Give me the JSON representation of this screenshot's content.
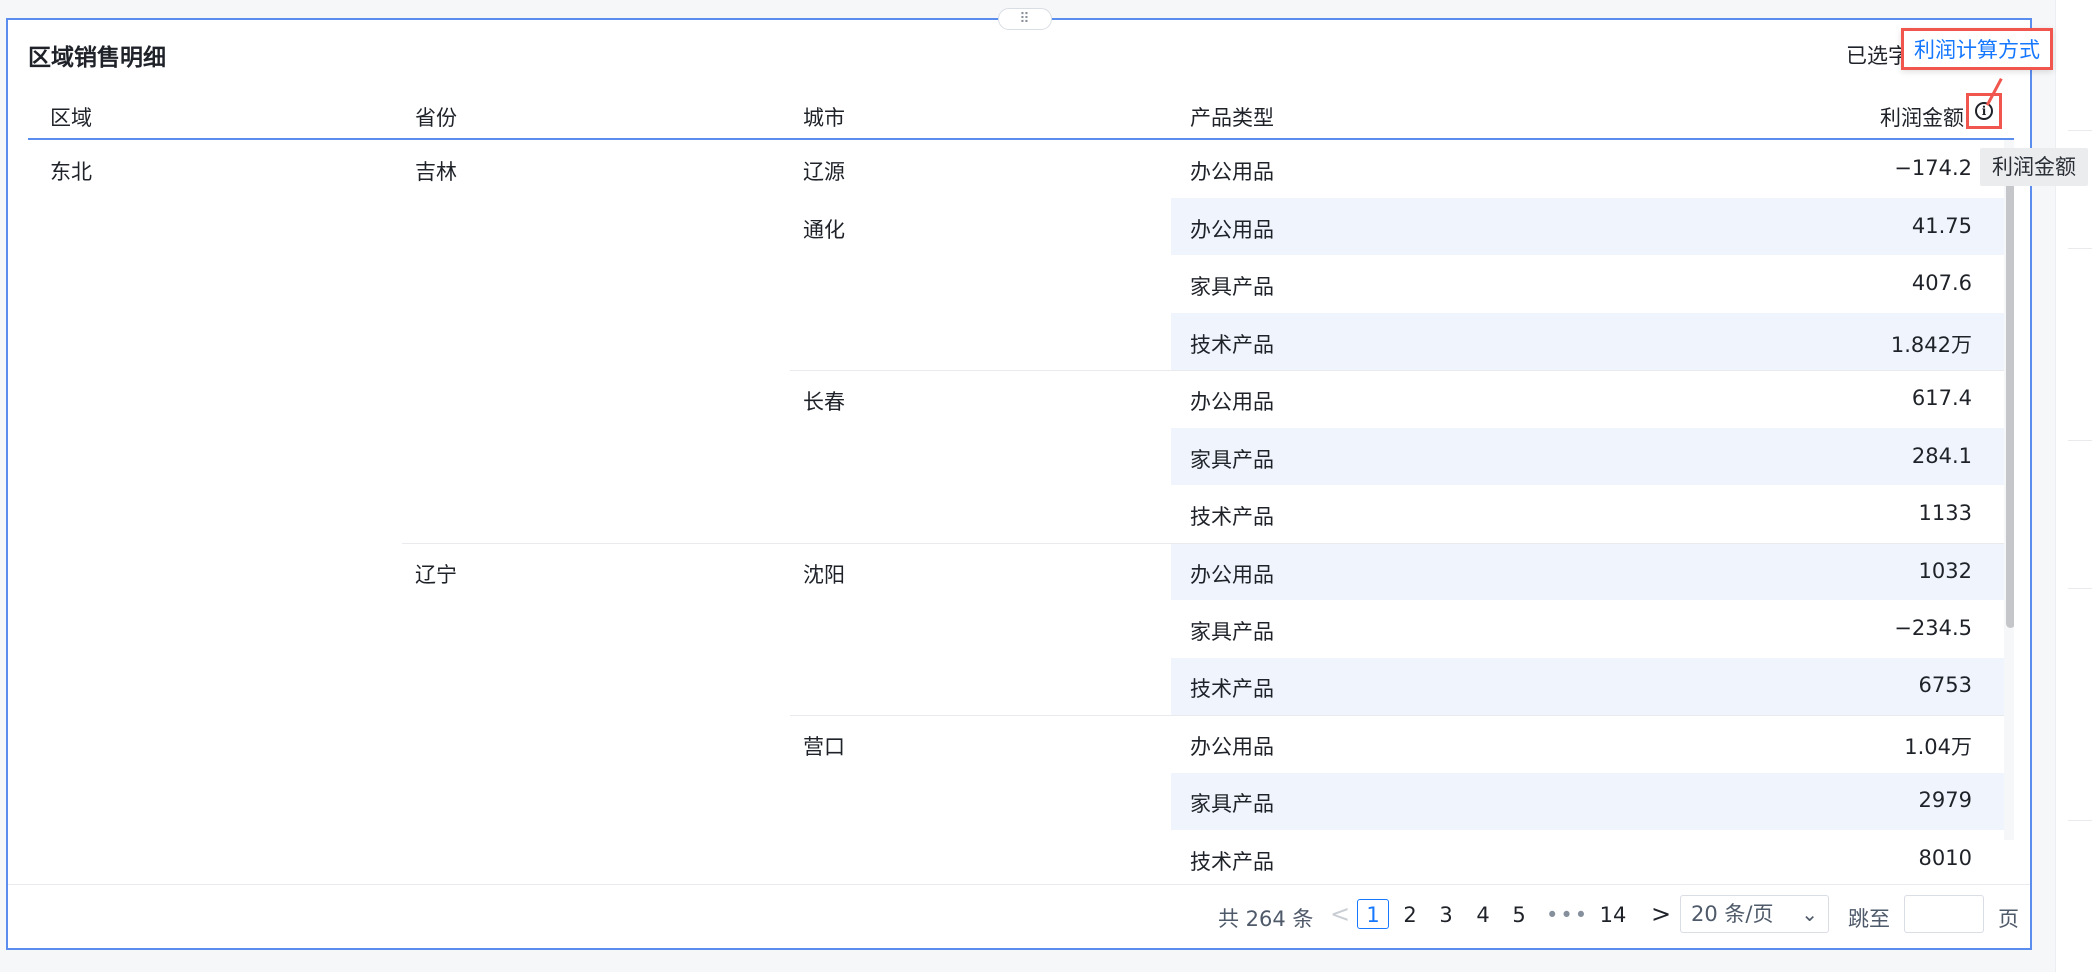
{
  "card": {
    "title": "区域销售明细",
    "selected_label": "已选字",
    "calc_link": "利润计算方式",
    "drag_handle": "⠿"
  },
  "table": {
    "headers": {
      "region": "区域",
      "province": "省份",
      "city": "城市",
      "type": "产品类型",
      "profit": "利润金额"
    },
    "groups": {
      "region": "东北",
      "province_jilin": "吉林",
      "province_liaoning": "辽宁",
      "city_liaoyuan": "辽源",
      "city_tonghua": "通化",
      "city_changchun": "长春",
      "city_shenyang": "沈阳",
      "city_yingkou": "营口"
    },
    "rows": [
      {
        "type": "办公用品",
        "value": "−174.2"
      },
      {
        "type": "办公用品",
        "value": "41.75"
      },
      {
        "type": "家具产品",
        "value": "407.6"
      },
      {
        "type": "技术产品",
        "value": "1.842万"
      },
      {
        "type": "办公用品",
        "value": "617.4"
      },
      {
        "type": "家具产品",
        "value": "284.1"
      },
      {
        "type": "技术产品",
        "value": "1133"
      },
      {
        "type": "办公用品",
        "value": "1032"
      },
      {
        "type": "家具产品",
        "value": "−234.5"
      },
      {
        "type": "技术产品",
        "value": "6753"
      },
      {
        "type": "办公用品",
        "value": "1.04万"
      },
      {
        "type": "家具产品",
        "value": "2979"
      },
      {
        "type": "技术产品",
        "value": "8010"
      }
    ]
  },
  "tooltip": "利润金额",
  "pagination": {
    "total": "共 264 条",
    "prev": "<",
    "pages": [
      "1",
      "2",
      "3",
      "4",
      "5"
    ],
    "more": "•••",
    "last": "14",
    "next": ">",
    "page_size": "20 条/页",
    "jump_label": "跳至",
    "page_label": "页",
    "current_page": 1
  },
  "colors": {
    "accent": "#1677ff",
    "border": "#5b8def",
    "highlight": "#f0564d",
    "stripe": "#f0f5fd"
  }
}
